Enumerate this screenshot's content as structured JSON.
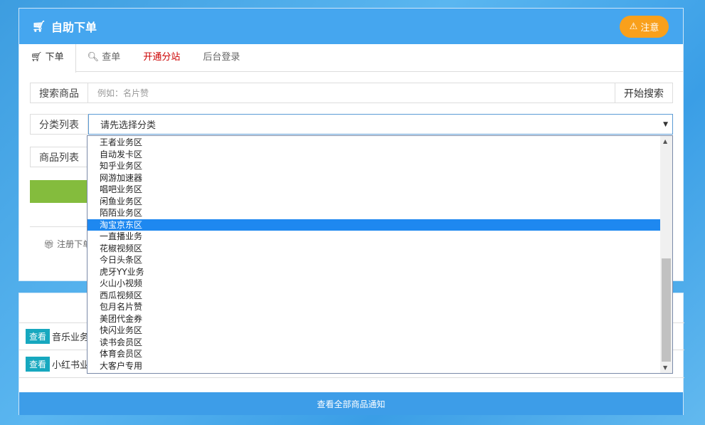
{
  "header": {
    "title": "自助下单",
    "notice_label": "注意"
  },
  "tabs": [
    {
      "label": "下单"
    },
    {
      "label": "查单"
    },
    {
      "label": "开通分站"
    },
    {
      "label": "后台登录"
    }
  ],
  "search": {
    "label": "搜索商品",
    "placeholder": "例如：名片赞",
    "button": "开始搜索"
  },
  "category": {
    "label": "分类列表",
    "selected": "请先选择分类"
  },
  "goods": {
    "label": "商品列表"
  },
  "register_text": "注册下单",
  "dropdown": {
    "highlighted_index": 7,
    "options": [
      "王者业务区",
      "自动发卡区",
      "知乎业务区",
      "网游加速器",
      "唱吧业务区",
      "闲鱼业务区",
      "陌陌业务区",
      "淘宝京东区",
      "一直播业务",
      "花椒视频区",
      "今日头条区",
      "虎牙YY业务",
      "火山小视频",
      "西瓜视频区",
      "包月名片赞",
      "美团代金券",
      "快闪业务区",
      "读书会员区",
      "体育会员区",
      "大客户专用"
    ]
  },
  "notices": [
    {
      "button": "查看",
      "text": "音乐业务"
    },
    {
      "button": "查看",
      "text": "小红书业"
    }
  ],
  "bottom_link": "查看全部商品通知",
  "colors": {
    "header": "#45a6ef",
    "notice": "#f9a01b",
    "highlight": "#1e88f0",
    "view_button": "#17a8bf",
    "green_button": "#84bc3d"
  }
}
